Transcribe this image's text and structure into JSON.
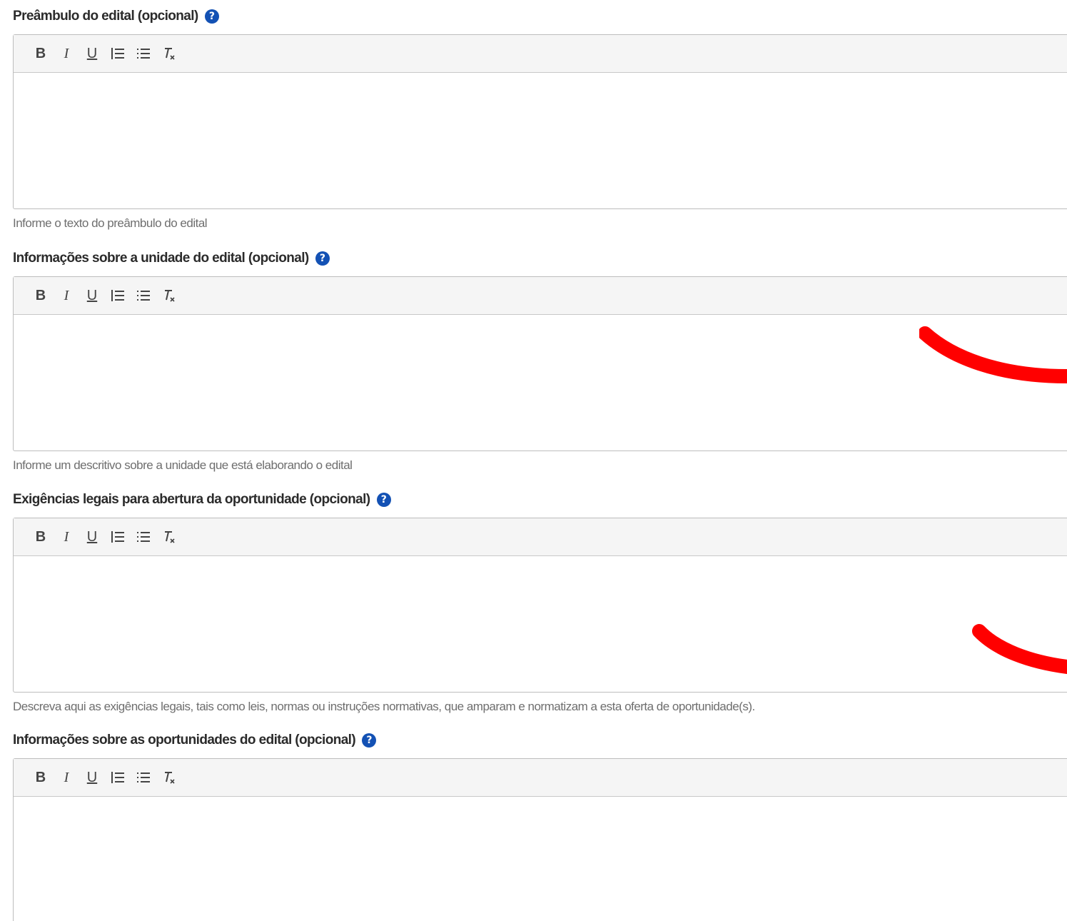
{
  "toolbar": {
    "bold_label": "B",
    "italic_label": "I",
    "underline_label": "U"
  },
  "fields": [
    {
      "label": "Preâmbulo do edital (opcional)",
      "hint": "Informe o texto do preâmbulo do edital",
      "value": ""
    },
    {
      "label": "Informações sobre a unidade do edital (opcional)",
      "hint": "Informe um descritivo sobre a unidade que está elaborando o edital",
      "value": ""
    },
    {
      "label": "Exigências legais para abertura da oportunidade (opcional)",
      "hint": "Descreva aqui as exigências legais, tais como leis, normas ou instruções normativas, que amparam e normatizam a esta oferta de oportunidade(s).",
      "value": ""
    },
    {
      "label": "Informações sobre as oportunidades do edital (opcional)",
      "hint": "",
      "value": ""
    }
  ],
  "colors": {
    "help_icon": "#1351b4",
    "annotation_mark": "#ff0000",
    "toolbar_bg": "#f5f5f5",
    "border": "#bdbdbd"
  },
  "icons": [
    "help-icon",
    "ordered-list-icon",
    "bullet-list-icon",
    "clear-format-icon"
  ]
}
